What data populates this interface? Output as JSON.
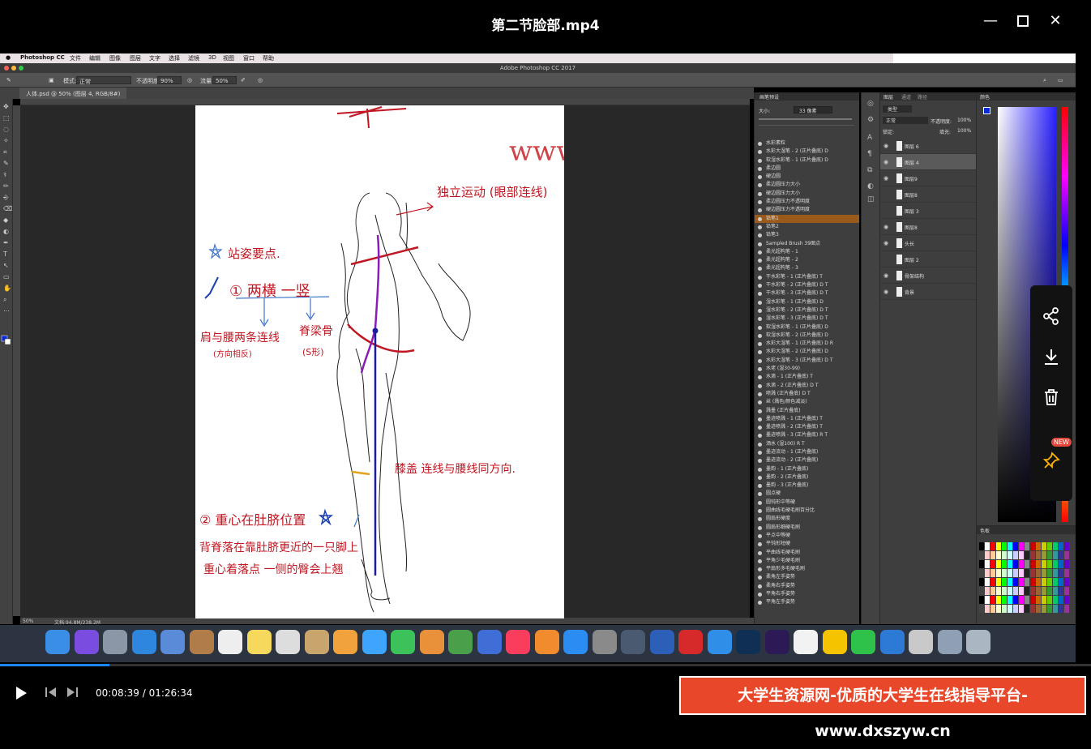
{
  "player": {
    "title": "第二节脸部.mp4",
    "current_time": "00:08:39",
    "separator": "/",
    "total_time": "01:26:34",
    "progress": 0.1,
    "banner": "大学生资源网-优质的大学生在线指导平台-www.dxszyw.cn",
    "side_toolbar_badge": "NEW"
  },
  "mac_menubar": {
    "app": "Photoshop CC",
    "items": [
      "文件",
      "编辑",
      "图像",
      "图层",
      "文字",
      "选择",
      "滤镜",
      "3D",
      "视图",
      "窗口",
      "帮助"
    ]
  },
  "ps": {
    "window_title": "Adobe Photoshop CC 2017",
    "options": {
      "mode_label": "模式:",
      "mode_value": "正常",
      "opacity_label": "不透明度:",
      "opacity_value": "90%",
      "flow_label": "流量:",
      "flow_value": "50%"
    },
    "document_tab": "人体.psd @ 50% (图层 4, RGB/8#)",
    "status_zoom": "50%",
    "status_doc": "文档:94.8M/238.2M",
    "brush_panel": {
      "title": "画笔预设",
      "size_label": "大小:",
      "size_value": "33 像素",
      "presets": [
        "水彩素粒",
        "水彩大湿笔 - 2 (正片叠底) D",
        "软湿水彩笔 - 1 (正片叠底) D",
        "柔边圆",
        "硬边圆",
        "柔边圆压力大小",
        "硬边圆压力大小",
        "柔边圆压力不透明度",
        "硬边圆压力不透明度",
        "铅笔1",
        "铅笔2",
        "铅笔3",
        "Sampled Brush 39图点",
        "柔光超构笔 - 1",
        "柔光超构笔 - 2",
        "柔光超构笔 - 3",
        "干水彩笔 - 1 (正片叠底) T",
        "干水彩笔 - 2 (正片叠底) D T",
        "干水彩笔 - 3 (正片叠底) D T",
        "湿水彩笔 - 1 (正片叠底) D",
        "湿水彩笔 - 2 (正片叠底) D T",
        "湿水彩笔 - 3 (正片叠底) D T",
        "软湿水彩笔 - 1 (正片叠底) D",
        "软湿水彩笔 - 2 (正片叠底) D",
        "水彩大湿笔 - 1 (正片叠底) D R",
        "水彩大湿笔 - 2 (正片叠底) D",
        "水彩大湿笔 - 3 (正片叠底) D T",
        "水佬 (湿30-99)",
        "水滴 - 1 (正片叠底) T",
        "水滴 - 2 (正片叠底) D T",
        "喷溅 (正片叠底) D T",
        "丝 (溅色/颜色减淡)",
        "溅墨 (正片叠底)",
        "墨迹喷溅 - 1 (正片叠底) T",
        "墨迹喷溅 - 2 (正片叠底) T",
        "墨迹喷溅 - 3 (正片叠底) R T",
        "洒水 (湿100) R T",
        "墨迹流动 - 1 (正片叠底)",
        "墨迹流动 - 2 (正片叠底)",
        "墨韵 - 1 (正片叠底)",
        "墨韵 - 2 (正片叠底)",
        "墨韵 - 3 (正片叠底)",
        "圆点硬",
        "圆钝形中等硬",
        "圆曲线毛硬毛刷百分比",
        "圆扇形硬度",
        "圆扇形细硬毛刷",
        "平点中等硬",
        "平钝形短硬",
        "平曲线毛硬毛刷",
        "平角少毛硬毛刷",
        "平扇形多毛硬毛刷",
        "柔角左手姿势",
        "柔角右手姿势",
        "平角右手姿势",
        "平角左手姿势"
      ],
      "active_index": 9
    },
    "layers_panel": {
      "tabs": [
        "图层",
        "通道",
        "路径"
      ],
      "kind_label": "类型",
      "blend": "正常",
      "opacity_label": "不透明度:",
      "opacity_value": "100%",
      "lock_label": "锁定:",
      "fill_label": "填充:",
      "fill_value": "100%",
      "layers": [
        {
          "name": "图层 6",
          "visible": true,
          "selected": false
        },
        {
          "name": "图层 4",
          "visible": true,
          "selected": true
        },
        {
          "name": "图层9",
          "visible": true,
          "selected": false
        },
        {
          "name": "图层8",
          "visible": false,
          "selected": false
        },
        {
          "name": "图层 3",
          "visible": false,
          "selected": false
        },
        {
          "name": "图层8",
          "visible": true,
          "selected": false
        },
        {
          "name": "头长",
          "visible": true,
          "selected": false
        },
        {
          "name": "图层 2",
          "visible": false,
          "selected": false
        },
        {
          "name": "骨架结构",
          "visible": true,
          "selected": false
        },
        {
          "name": "背景",
          "visible": true,
          "selected": false
        }
      ]
    },
    "color_panel_title": "颜色",
    "swatches_title": "色板"
  },
  "canvas": {
    "watermark": "www.dxszyw.c",
    "notes": {
      "arrow_label": "独立运动 (眼部连线)",
      "star_label": "站姿要点.",
      "point1": "① 两横 一竖",
      "left_branch": "肩与腰两条连线",
      "left_branch_sub": "(方向相反)",
      "right_branch": "脊梁骨",
      "right_branch_sub": "(S形)",
      "knee": "膝盖 连线与腰线同方向.",
      "point2": "② 重心在肚脐位置",
      "bottom1": "背脊落在靠肚脐更近的一只脚上",
      "bottom2": "重心着落点 一侧的臀会上翘"
    }
  },
  "dock_icons": [
    "finder",
    "siri",
    "launchpad",
    "safari",
    "mail",
    "contacts",
    "calendar",
    "notes",
    "reminders",
    "preview",
    "photos",
    "messages",
    "facetime",
    "pages",
    "numbers",
    "keynote",
    "music",
    "books",
    "app-store",
    "system-preferences",
    "quicktime",
    "word",
    "netease-music",
    "baidu-cloud",
    "photoshop",
    "premiere",
    "qq-1",
    "qq-2",
    "wechat",
    "browser",
    "folder",
    "downloads",
    "trash"
  ]
}
